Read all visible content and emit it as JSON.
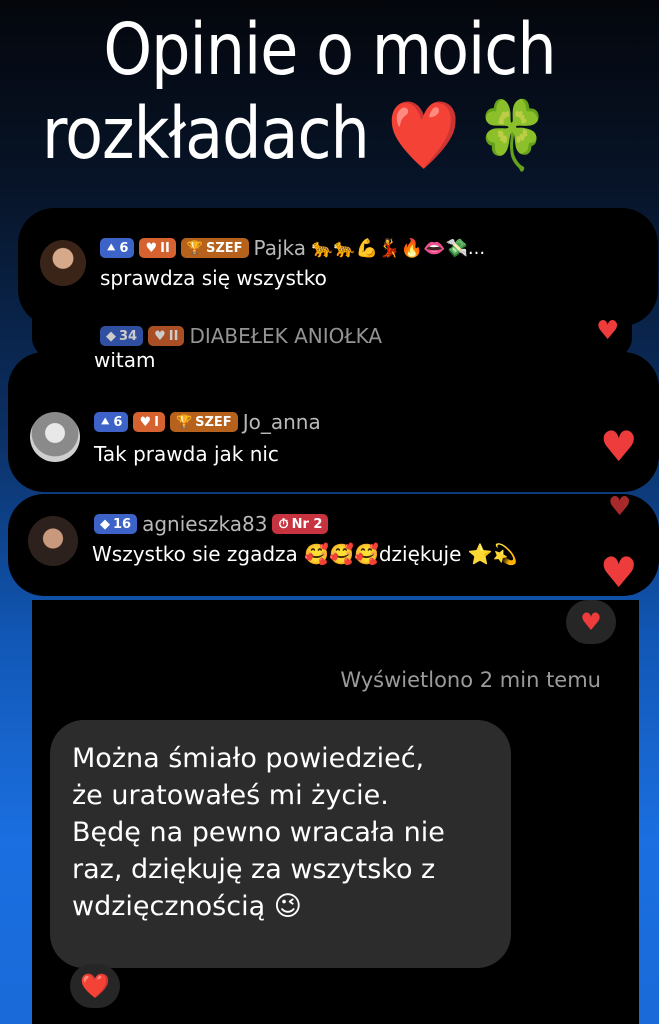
{
  "title": {
    "line1": "Opinie o moich",
    "line2": "rozkładach",
    "emoji": "❤️ 🍀"
  },
  "comments": [
    {
      "level": "6",
      "fan_level": "II",
      "role": "SZEF",
      "username": "Pajka",
      "username_emoji": "🐆🐆💪💃🔥👄💸...",
      "text": "sprawdza się wszystko"
    },
    {
      "level": "34",
      "fan_level": "II",
      "username": "DIABEŁEK ANIOŁKA",
      "text": "witam"
    },
    {
      "level": "6",
      "fan_level": "I",
      "role": "SZEF",
      "username": "Jo_anna",
      "text": "Tak prawda jak nic"
    },
    {
      "level": "16",
      "username": "agnieszka83",
      "rank": "Nr 2",
      "text": "Wszystko sie zgadza 🥰🥰🥰dziękuje ⭐💫"
    }
  ],
  "chat": {
    "seen_status": "Wyświetlono 2 min temu",
    "message": "Można śmiało powiedzieć,\nże uratowałeś mi życie.\nBędę na pewno wracała nie\nraz, dziękuję za wszytsko z\nwdzięcznością 😉",
    "reaction": "❤️"
  },
  "colors": {
    "heart": "#ee3b3b",
    "bubble": "#2c2c2c"
  },
  "icons": [
    "heart-icon",
    "diamond-level-icon",
    "trophy-icon"
  ]
}
